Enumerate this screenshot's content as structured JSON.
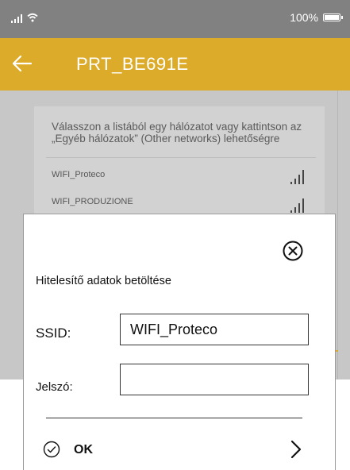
{
  "status_bar": {
    "battery_text": "100%"
  },
  "app_bar": {
    "title": "PRT_BE691E",
    "back_icon": "arrow-left-icon"
  },
  "network_list": {
    "instruction": "Válasszon a listából egy hálózatot vagy kattintson az „Egyéb hálózatok” (Other networks) lehetőségre",
    "networks": [
      {
        "name": "WIFI_Proteco",
        "icon": "wifi-signal-bars-icon"
      },
      {
        "name": "WIFI_PRODUZIONE",
        "icon": "wifi-signal-bars-icon"
      }
    ]
  },
  "dialog": {
    "title": "Hitelesítő adatok betöltése",
    "ssid_label": "SSID:",
    "ssid_value": "WIFI_Proteco",
    "password_label": "Jelszó:",
    "password_value": "",
    "ok_label": "OK",
    "close_icon": "close-circle-icon"
  },
  "colors": {
    "accent": "#ddab2a",
    "status_bar": "#818181",
    "overlay": "#c7c7c7"
  }
}
